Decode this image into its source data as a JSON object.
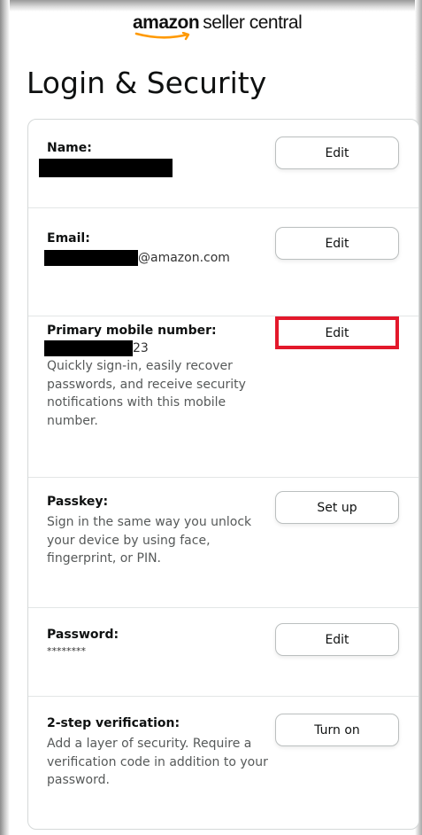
{
  "logo": {
    "brand": "amazon",
    "product": "seller central"
  },
  "page_title": "Login & Security",
  "rows": [
    {
      "label": "Name:",
      "button": "Edit"
    },
    {
      "label": "Email:",
      "value_suffix": "@amazon.com",
      "button": "Edit"
    },
    {
      "label": "Primary mobile number:",
      "value_suffix": "23",
      "description": "Quickly sign-in, easily recover passwords, and receive security notifications with this mobile number.",
      "button": "Edit",
      "highlight_color": "#e3182b"
    },
    {
      "label": "Passkey:",
      "description": "Sign in the same way you unlock your device by using face, fingerprint, or PIN.",
      "button": "Set up"
    },
    {
      "label": "Password:",
      "value": "********",
      "button": "Edit"
    },
    {
      "label": "2-step verification:",
      "description": "Add a layer of security. Require a verification code in addition to your password.",
      "button": "Turn on"
    }
  ],
  "colors": {
    "logo_smile": "#ff9900",
    "highlight": "#e3182b",
    "card_border": "#d5d9d9"
  }
}
